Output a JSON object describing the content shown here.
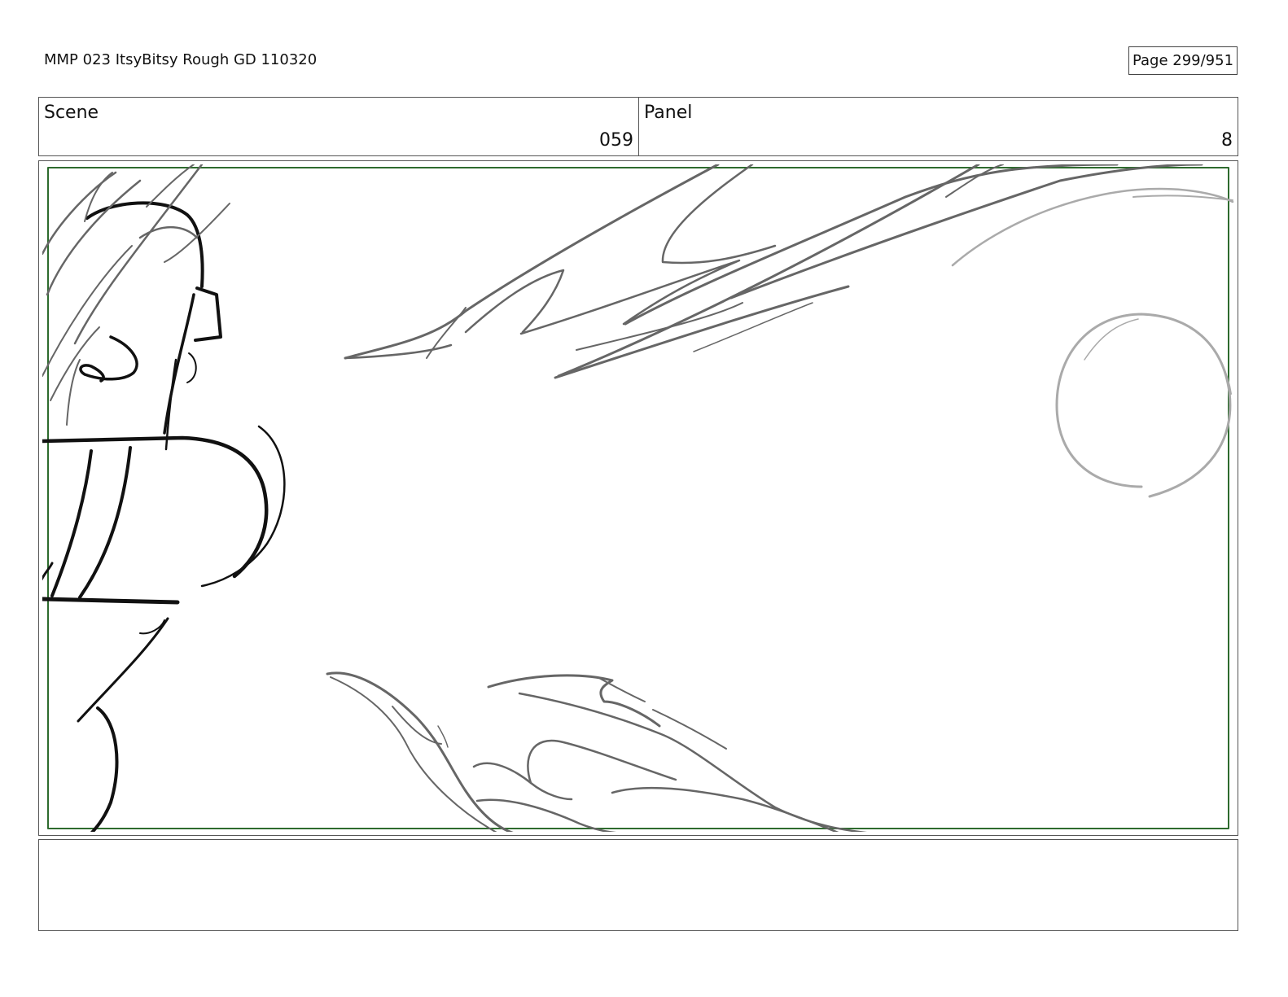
{
  "header": {
    "title": "MMP 023 ItsyBitsy Rough GD 110320",
    "page": "Page 299/951"
  },
  "scene": {
    "label": "Scene",
    "value": "059"
  },
  "panel": {
    "label": "Panel",
    "value": "8"
  },
  "colors": {
    "safe_frame": "#2e6b2e",
    "ink_dark": "#111111",
    "ink_mid": "#666666",
    "ink_light": "#aaaaaa"
  },
  "notes": ""
}
